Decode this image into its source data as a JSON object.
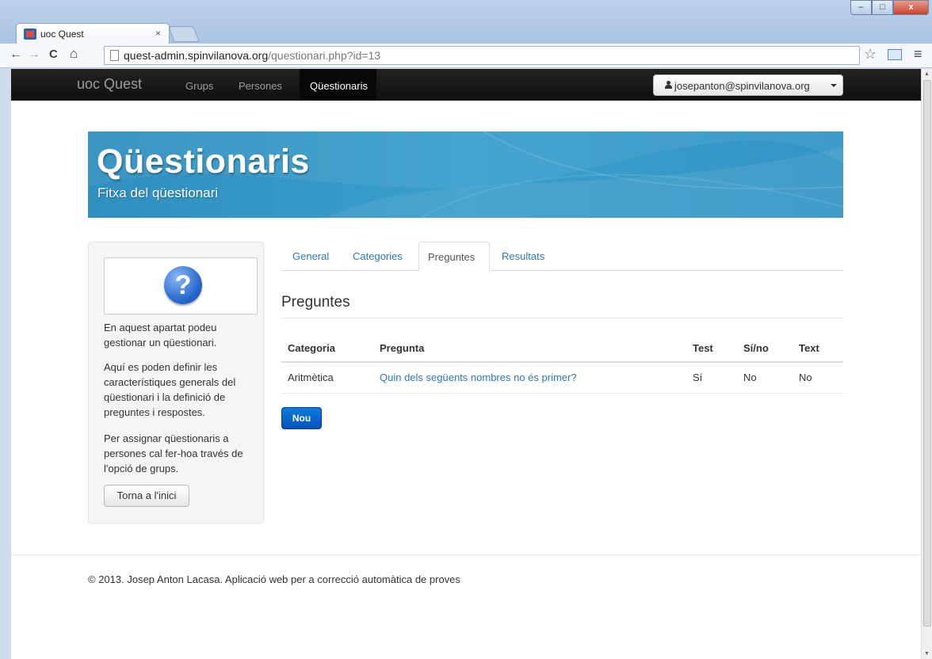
{
  "browser": {
    "tab_title": "uoc Quest",
    "tab_close": "×",
    "url_host": "quest-admin.spinvilanova.org",
    "url_path": "/questionari.php?id=13",
    "window_min": "–",
    "window_max": "□",
    "window_close": "x",
    "nav_back": "←",
    "nav_forward": "→",
    "nav_reload": "C",
    "nav_home": "⌂",
    "star": "☆",
    "menu": "≡"
  },
  "navbar": {
    "brand": "uoc Quest",
    "links": [
      "Grups",
      "Persones"
    ],
    "active": "Qüestionaris",
    "user": "josepanton@spinvilanova.org"
  },
  "hero": {
    "title": "Qüestionaris",
    "subtitle": "Fitxa del qüestionari"
  },
  "sidebar": {
    "icon": "?",
    "paragraphs": [
      "En aquest apartat podeu gestionar un qüestionari.",
      "Aquí es poden definir les característiques generals del qüestionari i la definició de preguntes i respostes.",
      "Per assignar qüestionaris a persones cal fer-hoa través de l'opció de grups."
    ],
    "home_button": "Torna a l'inici"
  },
  "tabs": {
    "items": [
      "General",
      "Categories",
      "Preguntes",
      "Resultats"
    ],
    "active": "Preguntes"
  },
  "section": {
    "title": "Preguntes"
  },
  "table": {
    "headers": [
      "Categoria",
      "Pregunta",
      "Test",
      "Sí/no",
      "Text"
    ],
    "rows": [
      [
        "Aritmètica",
        "Quin dels següents nombres no és primer?",
        "Sí",
        "No",
        "No"
      ]
    ]
  },
  "new_button": "Nou",
  "footer": "© 2013. Josep Anton Lacasa. Aplicació web per a correcció automàtica de proves",
  "colors": {
    "navbar": "#1b1b1b",
    "hero": "#3a9fcc",
    "link": "#2a7ab8",
    "primary_button": "#0a6fd6"
  }
}
